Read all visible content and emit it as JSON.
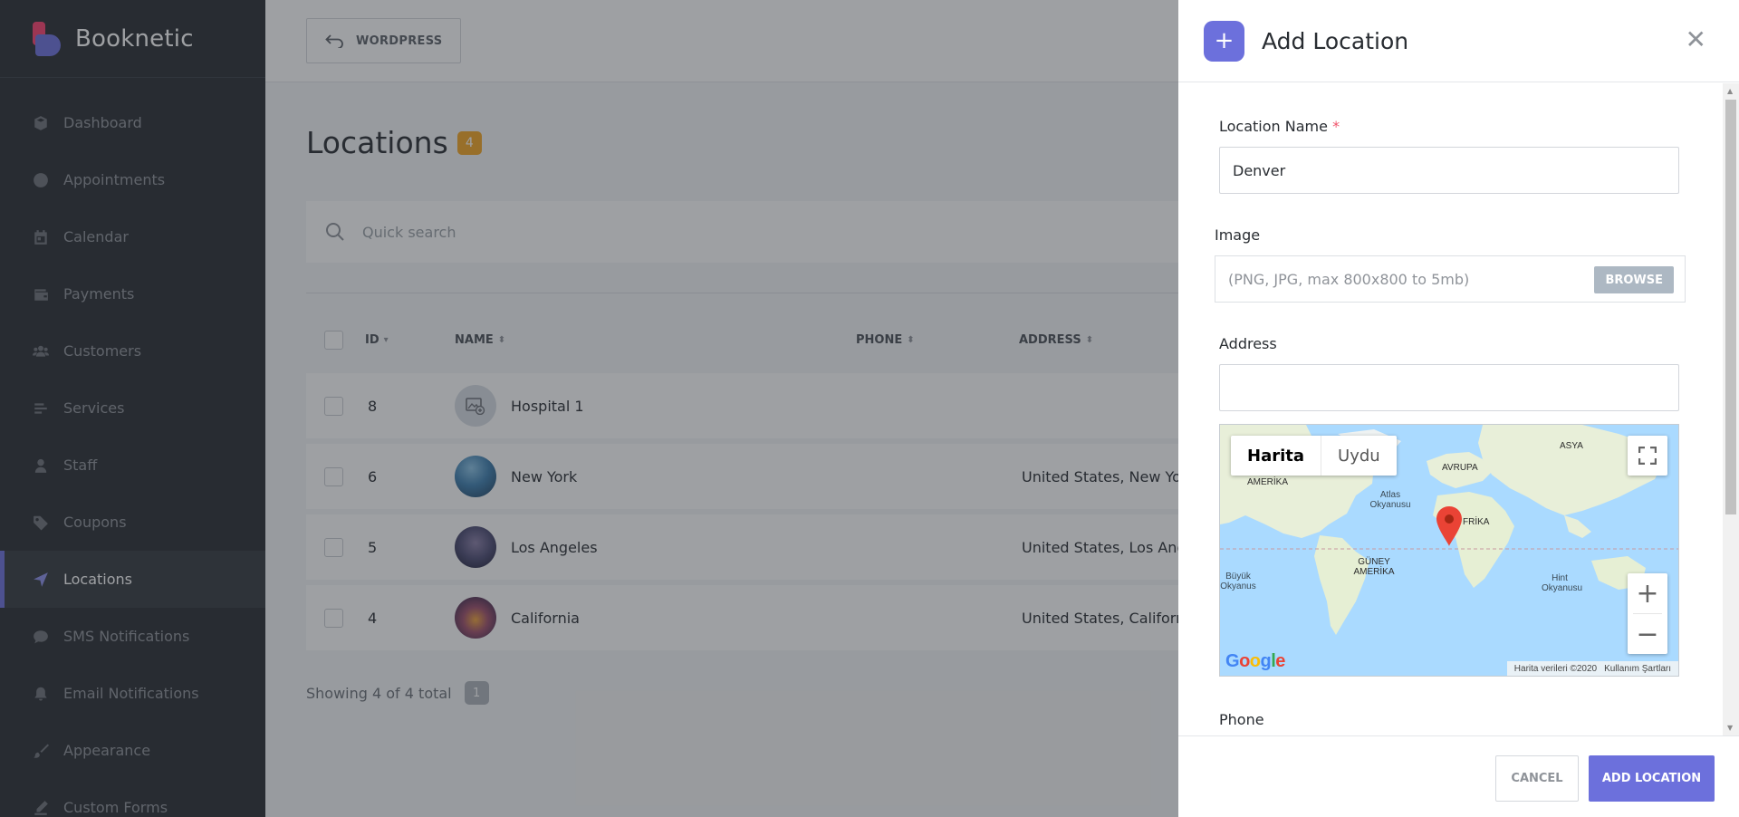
{
  "brand": {
    "name": "Booknetic",
    "accent": "#6c70dc",
    "logo_pink": "#fb3e6e"
  },
  "sidebar": {
    "items": [
      {
        "label": "Dashboard",
        "icon": "cube-icon"
      },
      {
        "label": "Appointments",
        "icon": "clock-icon"
      },
      {
        "label": "Calendar",
        "icon": "calendar-icon"
      },
      {
        "label": "Payments",
        "icon": "wallet-icon"
      },
      {
        "label": "Customers",
        "icon": "users-icon"
      },
      {
        "label": "Services",
        "icon": "list-icon"
      },
      {
        "label": "Staff",
        "icon": "user-icon"
      },
      {
        "label": "Coupons",
        "icon": "tag-icon"
      },
      {
        "label": "Locations",
        "icon": "location-arrow-icon",
        "active": true
      },
      {
        "label": "SMS Notifications",
        "icon": "chat-bubble-icon"
      },
      {
        "label": "Email Notifications",
        "icon": "bell-icon"
      },
      {
        "label": "Appearance",
        "icon": "brush-icon"
      },
      {
        "label": "Custom Forms",
        "icon": "form-icon"
      }
    ]
  },
  "topbar": {
    "wordpress_label": "WORDPRESS"
  },
  "page": {
    "title": "Locations",
    "count": "4",
    "search_placeholder": "Quick search"
  },
  "table": {
    "headers": {
      "id": "ID",
      "name": "NAME",
      "phone": "PHONE",
      "address": "ADDRESS"
    },
    "rows": [
      {
        "id": "8",
        "name": "Hospital 1",
        "address": ""
      },
      {
        "id": "6",
        "name": "New York",
        "address": "United States, New Yo"
      },
      {
        "id": "5",
        "name": "Los Angeles",
        "address": "United States, Los Ang"
      },
      {
        "id": "4",
        "name": "California",
        "address": "United States, Califorr"
      }
    ],
    "footer": "Showing 4 of 4 total",
    "page": "1"
  },
  "panel": {
    "title": "Add Location",
    "close_symbol": "✕",
    "location_name_label": "Location Name",
    "required_mark": "*",
    "location_name_value": "Denver",
    "image_label": "Image",
    "image_placeholder": "(PNG, JPG, max 800x800 to 5mb)",
    "browse_label": "BROWSE",
    "address_label": "Address",
    "address_value": "",
    "phone_label": "Phone",
    "cancel_label": "CANCEL",
    "add_label": "ADD LOCATION"
  },
  "map": {
    "type_map": "Harita",
    "type_satellite": "Uydu",
    "zoom_in": "+",
    "zoom_out": "−",
    "google": "Google",
    "data_credit": "Harita verileri ©2020",
    "terms": "Kullanım Şartları",
    "labels": {
      "asia": "ASYA",
      "europe": "AVRUPA",
      "north_america": "AMERİKA",
      "africa": "FRİKA",
      "south_america": "GÜNEY AMERİKA",
      "atlantic": "Atlas Okyanusu",
      "pacific": "Büyük Okyanus",
      "indian": "Hint Okyanusu"
    }
  }
}
